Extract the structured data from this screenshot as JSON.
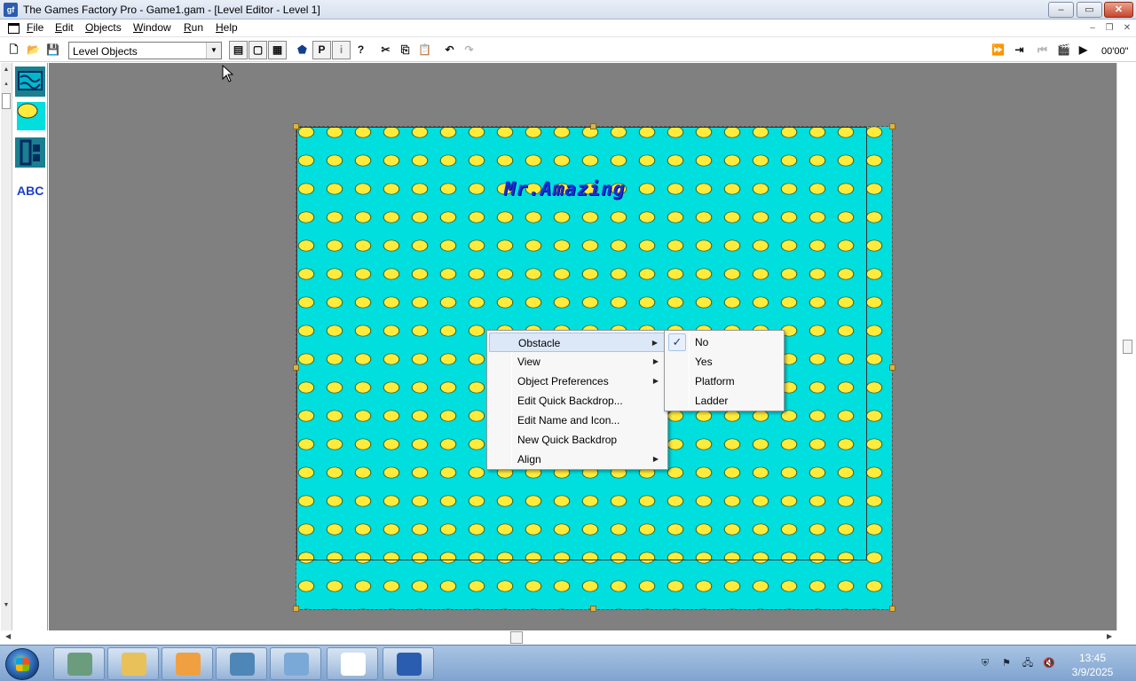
{
  "window": {
    "app_icon_text": "gf",
    "title": "The Games Factory Pro - Game1.gam - [Level Editor - Level 1]",
    "controls": {
      "minimize": "–",
      "maximize": "▭",
      "close": "✕"
    }
  },
  "menubar": {
    "items": [
      {
        "hotkey": "F",
        "rest": "ile"
      },
      {
        "hotkey": "E",
        "rest": "dit"
      },
      {
        "hotkey": "O",
        "rest": "bjects"
      },
      {
        "hotkey": "W",
        "rest": "indow"
      },
      {
        "hotkey": "R",
        "rest": "un"
      },
      {
        "hotkey": "H",
        "rest": "elp"
      }
    ],
    "mdi_controls": {
      "minimize": "–",
      "restore": "❐",
      "close": "✕"
    }
  },
  "toolbar": {
    "view_combo_value": "Level Objects",
    "time_display": "00'00\"",
    "buttons": {
      "new": "🗋",
      "open": "📂",
      "save": "💾",
      "storyboard": "▤",
      "level": "▢",
      "event": "▦",
      "obj1": "⬟",
      "obj2": "P",
      "info": "i",
      "help": "?",
      "cut": "✂",
      "copy": "⎘",
      "paste": "📋",
      "undo": "↶",
      "redo": "↷",
      "run_app": "⏩",
      "run_level": "⇥",
      "rewind": "⏮",
      "record": "🎬",
      "play": "▶"
    }
  },
  "palette": {
    "text_object_label": "ABC",
    "scroll_up": "▲",
    "scroll_up2": "▴",
    "scroll_down": "▼"
  },
  "frame": {
    "title_text": "Mr.Amazing",
    "background_color": "#00dede",
    "dot_color": "#ffeb3b"
  },
  "context_menu": {
    "items": [
      {
        "label": "Obstacle",
        "submenu": true
      },
      {
        "label": "View",
        "submenu": true
      },
      {
        "label": "Object Preferences",
        "submenu": true
      },
      {
        "label": "Edit Quick Backdrop...",
        "submenu": false
      },
      {
        "label": "Edit Name and Icon...",
        "submenu": false
      },
      {
        "label": "New Quick Backdrop",
        "submenu": false
      },
      {
        "label": "Align",
        "submenu": true
      }
    ],
    "submenu_arrow": "▶"
  },
  "obstacle_submenu": {
    "check_mark": "✓",
    "items": [
      {
        "label": "No",
        "checked": true
      },
      {
        "label": "Yes",
        "checked": false
      },
      {
        "label": "Platform",
        "checked": false
      },
      {
        "label": "Ladder",
        "checked": false
      }
    ]
  },
  "scrollbars": {
    "left": "◀",
    "right": "▶"
  },
  "taskbar": {
    "clock_time": "13:45",
    "clock_date": "3/9/2025",
    "tray": {
      "security": "⛨",
      "flag": "⚑",
      "network": "🖧",
      "volume": "🔇"
    }
  }
}
